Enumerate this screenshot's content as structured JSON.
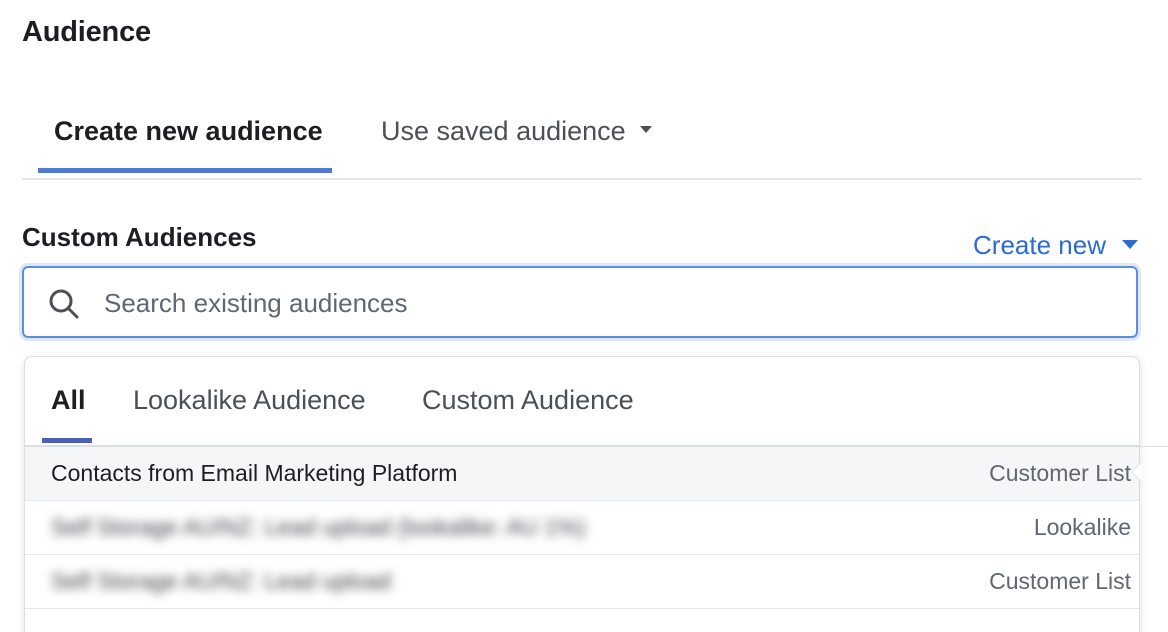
{
  "section": {
    "title": "Audience"
  },
  "main_tabs": [
    {
      "label": "Create new audience",
      "active": true
    },
    {
      "label": "Use saved audience",
      "active": false,
      "has_dropdown": true
    }
  ],
  "custom_audiences": {
    "label": "Custom Audiences",
    "create_new_label": "Create new",
    "search": {
      "placeholder": "Search existing audiences",
      "value": ""
    }
  },
  "dropdown": {
    "tabs": [
      {
        "label": "All",
        "active": true
      },
      {
        "label": "Lookalike Audience",
        "active": false
      },
      {
        "label": "Custom Audience",
        "active": false
      }
    ],
    "rows": [
      {
        "name": "Contacts from Email Marketing Platform",
        "type": "Customer List",
        "blurred": false,
        "hovered": true
      },
      {
        "name": "Self Storage AU/NZ: Lead upload (lookalike: AU 1%)",
        "type": "Lookalike",
        "blurred": true,
        "hovered": false
      },
      {
        "name": "Self Storage AU/NZ: Lead upload",
        "type": "Customer List",
        "blurred": true,
        "hovered": false
      }
    ]
  },
  "colors": {
    "accent_blue": "#4a7bd7",
    "link_blue": "#2b6bd6",
    "text_primary": "#1c1e21",
    "text_secondary": "#606770"
  }
}
